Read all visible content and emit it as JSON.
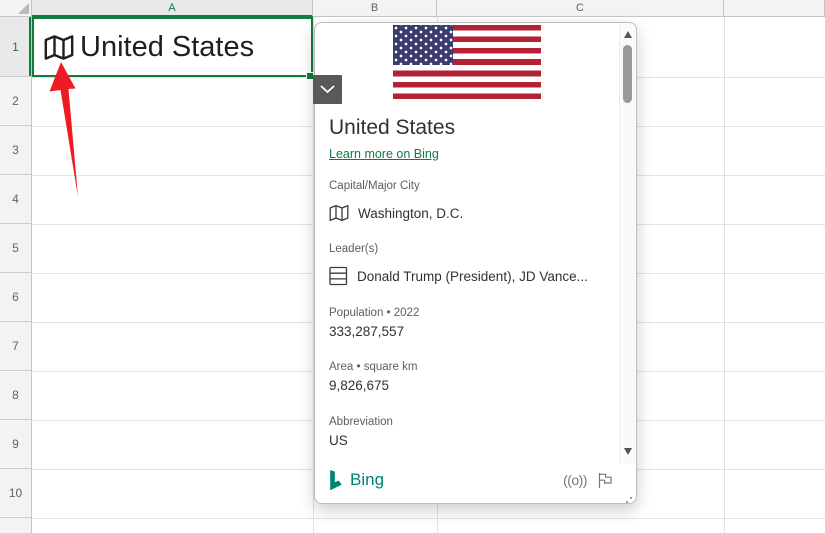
{
  "grid": {
    "column_headers": [
      "A",
      "B",
      "C"
    ],
    "row_numbers": [
      "1",
      "2",
      "3",
      "4",
      "5",
      "6",
      "7",
      "8",
      "9",
      "10"
    ],
    "a1": {
      "value": "United States",
      "icon": "map-icon"
    }
  },
  "card": {
    "title": "United States",
    "link_label": "Learn more on Bing",
    "fields": [
      {
        "label": "Capital/Major City",
        "value": "Washington, D.C.",
        "icon": "map-icon"
      },
      {
        "label": "Leader(s)",
        "value": "Donald Trump (President), JD Vance...",
        "icon": "table-icon"
      },
      {
        "label": "Population • 2022",
        "value": "333,287,557"
      },
      {
        "label": "Area • square km",
        "value": "9,826,675"
      },
      {
        "label": "Abbreviation",
        "value": "US"
      }
    ],
    "footer": {
      "brand": "Bing",
      "icons": [
        "sensitivity-icon",
        "report-flag-icon"
      ],
      "sensitivity_glyph": "((o))"
    }
  },
  "colors": {
    "accent_green": "#107C41",
    "bing_teal": "#008373",
    "arrow_red": "#ED1C24",
    "flag_red": "#B22234",
    "flag_navy": "#3C3B6E"
  }
}
